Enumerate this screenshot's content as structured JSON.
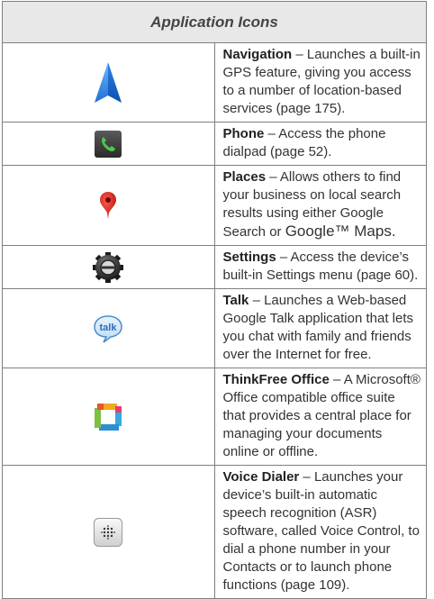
{
  "table": {
    "title": "Application Icons",
    "rows": [
      {
        "icon": "navigation-arrow-icon",
        "name": "Navigation",
        "text": " – Launches a built-in GPS feature, giving you access to a number of location-based services (page 175)."
      },
      {
        "icon": "phone-icon",
        "name": "Phone",
        "text": " – Access the phone dialpad (page 52)."
      },
      {
        "icon": "map-pin-icon",
        "name": "Places",
        "text": " – Allows others to find your business on local search results using either Google Search or ",
        "text_big": "Google™ Maps."
      },
      {
        "icon": "settings-gear-icon",
        "name": "Settings",
        "text": " – Access the device’s built-in Settings menu (page 60)."
      },
      {
        "icon": "talk-bubble-icon",
        "name": "Talk",
        "icon_label": "talk",
        "text": " – Launches a Web-based Google Talk application that lets you chat with family and friends over the Internet for free."
      },
      {
        "icon": "thinkfree-office-icon",
        "name": "ThinkFree Office",
        "text": " – A Microsoft® Office compatible office suite that provides a central place for managing your documents online or offline."
      },
      {
        "icon": "voice-dialer-icon",
        "name": "Voice Dialer",
        "text": " – Launches your device’s built-in automatic speech recognition (ASR) software, called Voice Control, to dial a phone number in your Contacts or to launch phone functions (page 109)."
      }
    ]
  }
}
